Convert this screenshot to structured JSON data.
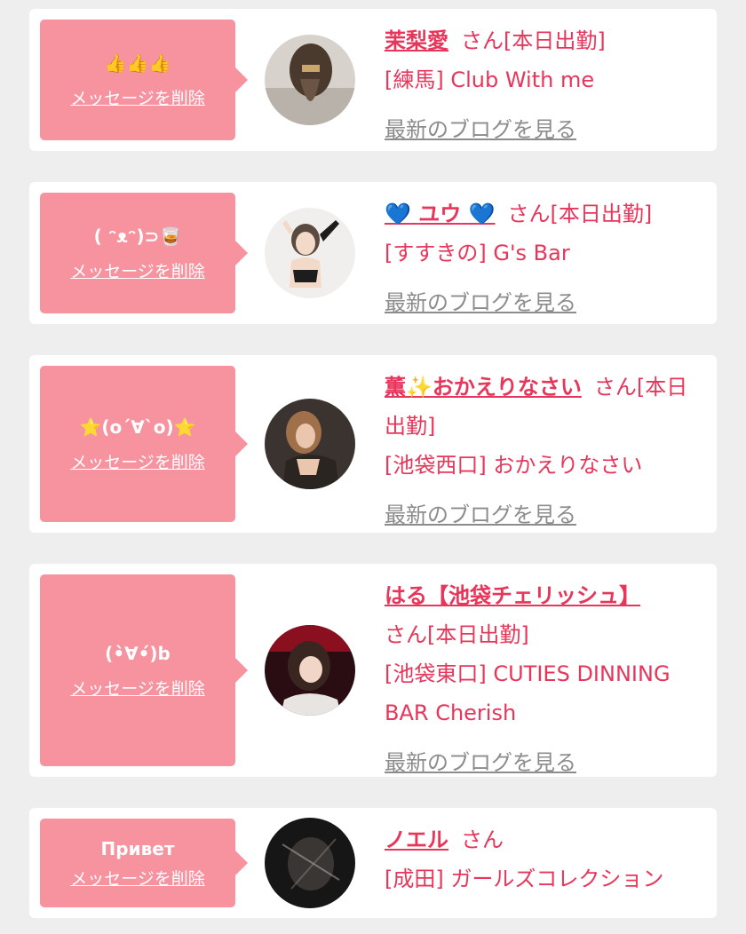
{
  "cards": [
    {
      "message": "👍👍👍",
      "delete_label": "メッセージを削除",
      "name": "茉梨愛",
      "status": "さん[本日出勤]",
      "shop": "[練馬] Club With me",
      "blog_label": "最新のブログを見る"
    },
    {
      "message": "( ᵔᴥᵔ)⊃🥃",
      "delete_label": "メッセージを削除",
      "name_prefix": "💙",
      "name": "ユウ",
      "name_suffix": "💙",
      "status": "さん[本日出勤]",
      "shop": "[すすきの] G's Bar",
      "blog_label": "最新のブログを見る"
    },
    {
      "message": "⭐(o´∀`o)⭐",
      "delete_label": "メッセージを削除",
      "name": "薫✨おかえりなさい",
      "status": "さん[本日出勤]",
      "shop": "[池袋西口] おかえりなさい",
      "blog_label": "最新のブログを見る"
    },
    {
      "message": "(•̀∀•́)b",
      "delete_label": "メッセージを削除",
      "name": "はる【池袋チェリッシュ】",
      "status": "さん[本日出勤]",
      "shop": "[池袋東口] CUTIES DINNING BAR Cherish",
      "blog_label": "最新のブログを見る"
    },
    {
      "message": "Привет",
      "delete_label": "メッセージを削除",
      "name": "ノエル",
      "status": "さん",
      "shop": "[成田] ガールズコレクション",
      "blog_label": ""
    }
  ]
}
